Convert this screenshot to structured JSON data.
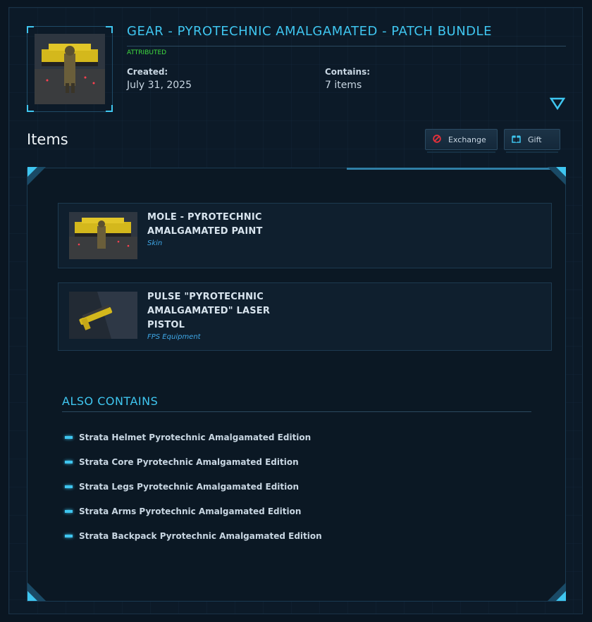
{
  "bundle": {
    "title": "GEAR - PYROTECHNIC AMALGAMATED - PATCH BUNDLE",
    "status": "ATTRIBUTED",
    "created_label": "Created:",
    "created_value": "July 31, 2025",
    "contains_label": "Contains:",
    "contains_value": "7 items",
    "image": "mining-vehicle-thumbnail"
  },
  "items_section": {
    "heading": "Items",
    "exchange_label": "Exchange",
    "gift_label": "Gift",
    "exchange_icon": "no-entry-icon",
    "gift_icon": "gift-box-icon"
  },
  "items": [
    {
      "name": "MOLE - PYROTECHNIC AMALGAMATED PAINT",
      "type": "Skin",
      "image": "mining-vehicle-thumbnail"
    },
    {
      "name": "PULSE \"PYROTECHNIC AMALGAMATED\" LASER PISTOL",
      "type": "FPS Equipment",
      "image": "laser-pistol-thumbnail"
    }
  ],
  "also_contains": {
    "heading": "ALSO CONTAINS",
    "entries": [
      "Strata Helmet Pyrotechnic Amalgamated Edition",
      "Strata Core Pyrotechnic Amalgamated Edition",
      "Strata Legs Pyrotechnic Amalgamated Edition",
      "Strata Arms Pyrotechnic Amalgamated Edition",
      "Strata Backpack Pyrotechnic Amalgamated Edition"
    ]
  },
  "colors": {
    "accent": "#3fc6f0",
    "attributed": "#3fdc3f",
    "item_type": "#3fa8e8",
    "background": "#0c1a28"
  }
}
